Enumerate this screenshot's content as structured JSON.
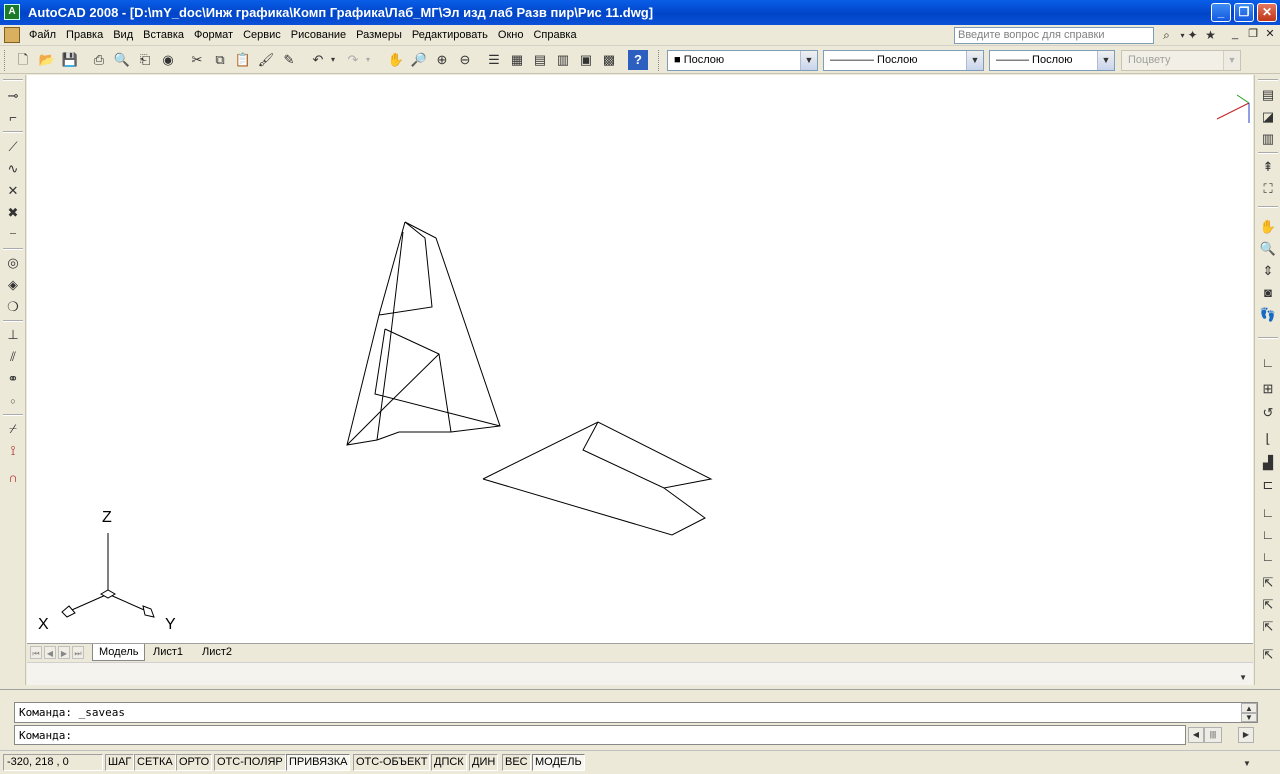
{
  "window": {
    "title": "AutoCAD 2008 - [D:\\mY_doc\\Инж графика\\Комп Графика\\Лаб_МГ\\Эл изд лаб Разв пир\\Рис 11.dwg]",
    "app_icon_glyph": "A",
    "minimize": "_",
    "restore": "❐",
    "close": "✕"
  },
  "menu": {
    "items": [
      {
        "label": "Файл"
      },
      {
        "label": "Правка"
      },
      {
        "label": "Вид"
      },
      {
        "label": "Вставка"
      },
      {
        "label": "Формат"
      },
      {
        "label": "Сервис"
      },
      {
        "label": "Рисование"
      },
      {
        "label": "Размеры"
      },
      {
        "label": "Редактировать"
      },
      {
        "label": "Окно"
      },
      {
        "label": "Справка"
      }
    ],
    "help_placeholder": "Введите вопрос для справки",
    "doc_minimize": "_",
    "doc_restore": "❐",
    "doc_close": "✕"
  },
  "toolbar": {
    "layer_color_combo": "■ Послою",
    "linetype_combo": "———— Послою",
    "lineweight_combo": "——— Послою",
    "plotstyle_combo": "Поцвету"
  },
  "ucs": {
    "z_label": "Z",
    "x_label": "X",
    "y_label": "Y"
  },
  "tabs": [
    {
      "label": "Модель",
      "active": true
    },
    {
      "label": "Лист1",
      "active": false
    },
    {
      "label": "Лист2",
      "active": false
    }
  ],
  "command": {
    "history_line": "Команда: _saveas",
    "prompt": "Команда:"
  },
  "status": {
    "coords": "-320, 218 , 0",
    "buttons": [
      {
        "label": "ШАГ",
        "pressed": false
      },
      {
        "label": "СЕТКА",
        "pressed": false
      },
      {
        "label": "ОРТО",
        "pressed": false
      },
      {
        "label": "ОТС-ПОЛЯР",
        "pressed": false
      },
      {
        "label": "ПРИВЯЗКА",
        "pressed": true
      },
      {
        "label": "ОТС-ОБЪЕКТ",
        "pressed": false
      },
      {
        "label": "ДПСК",
        "pressed": false
      },
      {
        "label": "ДИН",
        "pressed": false
      },
      {
        "label": "ВЕС",
        "pressed": false
      },
      {
        "label": "МОДЕЛЬ",
        "pressed": true
      }
    ]
  }
}
